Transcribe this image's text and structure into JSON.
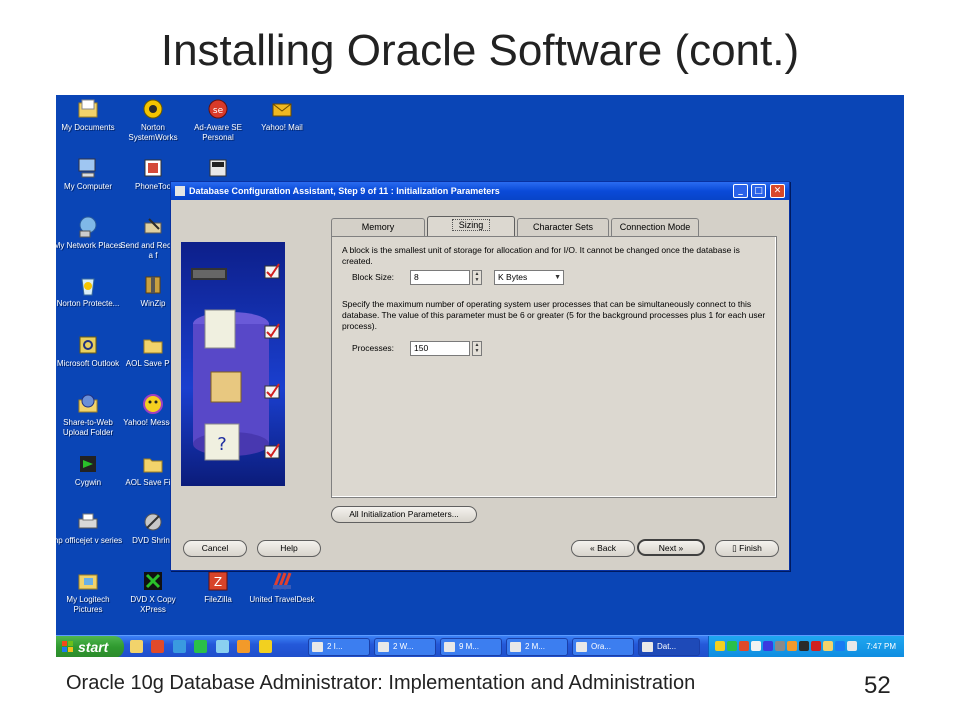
{
  "slide": {
    "title": "Installing Oracle Software (cont.)",
    "footer": "Oracle 10g Database Administrator: Implementation and Administration",
    "page_number": "52"
  },
  "desktop": {
    "icons": [
      {
        "name": "my-documents",
        "label": "My Documents",
        "color": "#f2d36b"
      },
      {
        "name": "norton-systemworks",
        "label": "Norton SystemWorks",
        "color": "#f5c400"
      },
      {
        "name": "ad-aware",
        "label": "Ad-Aware SE Personal",
        "color": "#d83a2a"
      },
      {
        "name": "yahoo-mail",
        "label": "Yahoo! Mail",
        "color": "#f0b820"
      },
      {
        "name": "my-computer",
        "label": "My Computer",
        "color": "#9fc6f2"
      },
      {
        "name": "phonetools",
        "label": "PhoneToo",
        "color": "#d44a3a"
      },
      {
        "name": "dvd-icon",
        "label": "",
        "color": "#e8e8e8"
      },
      {
        "name": "my-network-places",
        "label": "My Network Places",
        "color": "#7fb8e8"
      },
      {
        "name": "send-and-receive",
        "label": "Send and Receive a f",
        "color": "#e0d0a0"
      },
      {
        "name": "norton-protected",
        "label": "Norton Protecte...",
        "color": "#f5c400"
      },
      {
        "name": "winzip",
        "label": "WinZip",
        "color": "#c8a040"
      },
      {
        "name": "microsoft-outlook",
        "label": "Microsoft Outlook",
        "color": "#e8d060"
      },
      {
        "name": "aol-save-pfc",
        "label": "AOL Save PFC",
        "color": "#f2d36b"
      },
      {
        "name": "share-to-web",
        "label": "Share-to-Web Upload Folder",
        "color": "#6a8fd8"
      },
      {
        "name": "yahoo-messenger",
        "label": "Yahoo! Messeng",
        "color": "#a040c0"
      },
      {
        "name": "cygwin",
        "label": "Cygwin",
        "color": "#222222"
      },
      {
        "name": "aol-save-files",
        "label": "AOL Save Files",
        "color": "#f2d36b"
      },
      {
        "name": "hp-officejet",
        "label": "hp officejet v series",
        "color": "#d8d8d8"
      },
      {
        "name": "dvd-shrink",
        "label": "DVD Shrink",
        "color": "#c8c8c8"
      },
      {
        "name": "my-logitech-pictures",
        "label": "My Logitech Pictures",
        "color": "#f2d36b"
      },
      {
        "name": "dvd-x-copy",
        "label": "DVD X Copy XPress",
        "color": "#2a9a2a"
      },
      {
        "name": "filezilla",
        "label": "FileZilla",
        "color": "#d8442a"
      },
      {
        "name": "united-traveldesk",
        "label": "United TravelDesk",
        "color": "#3a5ab8"
      }
    ]
  },
  "taskbar": {
    "start_label": "start",
    "buttons": [
      "2 I...",
      "2 W...",
      "9 M...",
      "2 M...",
      "Ora...",
      "Dat..."
    ],
    "clock": "7:47 PM"
  },
  "dialog": {
    "title": "Database Configuration Assistant, Step 9 of 11 : Initialization Parameters",
    "window_buttons": {
      "minimize": "_",
      "maximize": "□",
      "close": "✕"
    },
    "tabs": [
      "Memory",
      "Sizing",
      "Character Sets",
      "Connection Mode"
    ],
    "selected_tab": "Sizing",
    "block_size_description": "A block is the smallest unit of storage for allocation and for I/O. It cannot be changed once the database is created.",
    "block_size_label": "Block Size:",
    "block_size_value": "8",
    "block_size_unit": "K Bytes",
    "processes_description": "Specify the maximum number of operating system user processes that can be simultaneously connect to this database. The value of this parameter must be 6 or greater (5 for the background processes plus 1 for each user process).",
    "processes_label": "Processes:",
    "processes_value": "150",
    "all_params_label": "All Initialization Parameters...",
    "cancel_label": "Cancel",
    "help_label": "Help",
    "back_label": "Back",
    "next_label": "Next",
    "finish_label": "Finish"
  }
}
